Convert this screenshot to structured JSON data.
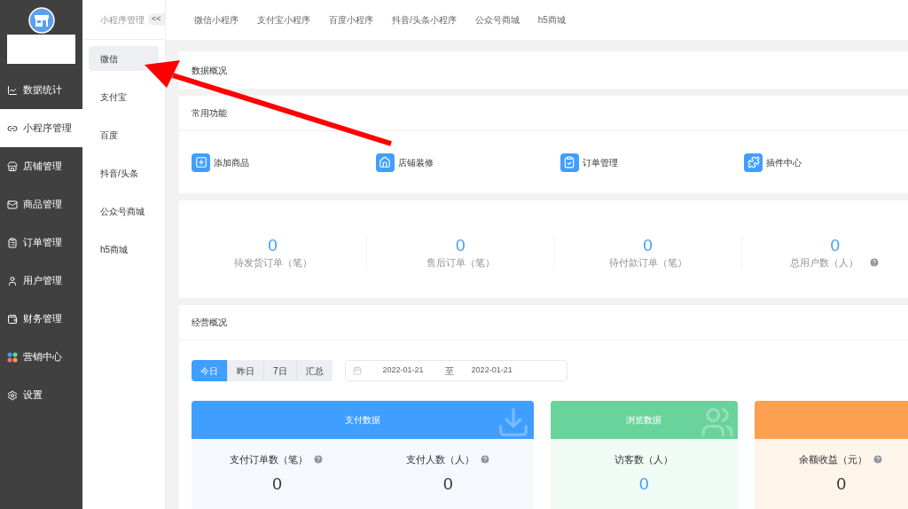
{
  "sidebar": {
    "items": [
      {
        "label": "数据统计",
        "selected": false
      },
      {
        "label": "小程序管理",
        "selected": true
      },
      {
        "label": "店铺管理",
        "selected": false
      },
      {
        "label": "商品管理",
        "selected": false
      },
      {
        "label": "订单管理",
        "selected": false
      },
      {
        "label": "用户管理",
        "selected": false
      },
      {
        "label": "财务管理",
        "selected": false
      },
      {
        "label": "营销中心",
        "selected": false
      },
      {
        "label": "设置",
        "selected": false
      }
    ]
  },
  "subnav": {
    "title": "小程序管理",
    "collapse": "<<",
    "items": [
      {
        "label": "微信",
        "selected": true
      },
      {
        "label": "支付宝",
        "selected": false
      },
      {
        "label": "百度",
        "selected": false
      },
      {
        "label": "抖音/头条",
        "selected": false
      },
      {
        "label": "公众号商城",
        "selected": false
      },
      {
        "label": "h5商城",
        "selected": false
      }
    ]
  },
  "top_tabs": [
    "微信小程序",
    "支付宝小程序",
    "百度小程序",
    "抖音/头条小程序",
    "公众号商城",
    "h5商城"
  ],
  "overview": {
    "title": "数据概况"
  },
  "functions": {
    "title": "常用功能",
    "items": [
      "添加商品",
      "店铺装修",
      "订单管理",
      "插件中心"
    ]
  },
  "stats": [
    {
      "value": "0",
      "label": "待发货订单（笔）",
      "help": false
    },
    {
      "value": "0",
      "label": "售后订单（笔）",
      "help": false
    },
    {
      "value": "0",
      "label": "待付款订单（笔）",
      "help": false
    },
    {
      "value": "0",
      "label": "总用户数（人）",
      "help": true
    }
  ],
  "business": {
    "title": "经营概况",
    "ranges": [
      {
        "label": "今日",
        "selected": true
      },
      {
        "label": "昨日",
        "selected": false
      },
      {
        "label": "7日",
        "selected": false
      },
      {
        "label": "汇总",
        "selected": false
      }
    ],
    "date_from": "2022-01-21",
    "date_sep": "至",
    "date_to": "2022-01-21",
    "cards": [
      {
        "kind": "payment",
        "title": "支付数据",
        "color": "#409eff",
        "metrics": [
          {
            "label": "支付订单数（笔）",
            "value": "0",
            "help": true,
            "highlighted": false
          },
          {
            "label": "支付人数（人）",
            "value": "0",
            "help": true,
            "highlighted": false
          }
        ]
      },
      {
        "kind": "browse",
        "title": "浏览数据",
        "color": "#6ad39c",
        "metrics": [
          {
            "label": "访客数（人）",
            "value": "0",
            "help": false,
            "highlighted": true
          }
        ]
      },
      {
        "kind": "income",
        "color": "#fca050",
        "metrics": [
          {
            "label": "余额收益（元）",
            "value": "0",
            "help": true,
            "highlighted": false
          }
        ]
      }
    ]
  }
}
